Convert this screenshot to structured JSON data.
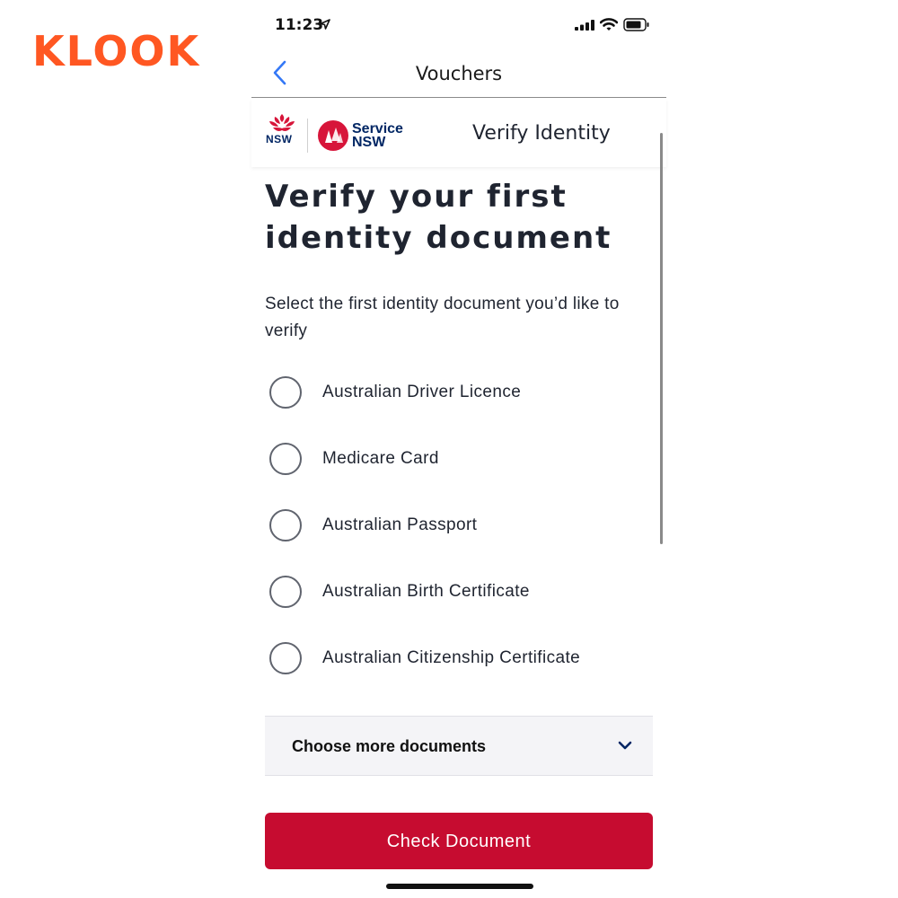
{
  "brand": {
    "name": "KLOOK",
    "color": "#ff5722"
  },
  "status_bar": {
    "time": "11:23"
  },
  "nav": {
    "title": "Vouchers",
    "back_icon": "chevron-left-icon"
  },
  "header": {
    "gov_logo_text": "NSW",
    "service_logo_line1": "Service",
    "service_logo_line2": "NSW",
    "title": "Verify Identity"
  },
  "main": {
    "heading": "Verify your first identity document",
    "intro": "Select the first identity document you’d like to verify",
    "options": [
      {
        "label": "Australian Driver Licence",
        "selected": false
      },
      {
        "label": "Medicare Card",
        "selected": false
      },
      {
        "label": "Australian Passport",
        "selected": false
      },
      {
        "label": "Australian Birth Certificate",
        "selected": false
      },
      {
        "label": "Australian Citizenship Certificate",
        "selected": false
      }
    ],
    "more_documents_label": "Choose more documents",
    "check_button_label": "Check Document"
  },
  "colors": {
    "accent_red": "#c60c30",
    "nsw_blue": "#002664",
    "ios_blue": "#3478f6"
  }
}
